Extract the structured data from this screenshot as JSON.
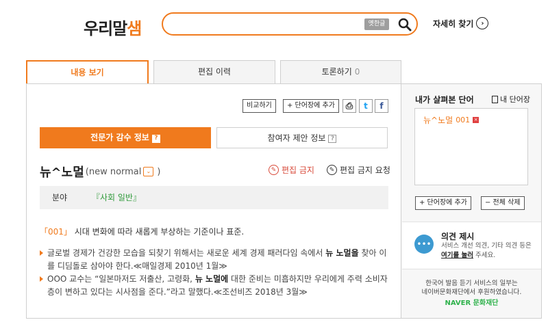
{
  "header": {
    "logo_part1": "우리말",
    "logo_part2": "샘",
    "search_value": "",
    "old_hangul_btn": "옛한글",
    "advanced_search": "자세히 찾기",
    "advanced_icon": "›"
  },
  "tabs": [
    {
      "label": "내용 보기",
      "count": ""
    },
    {
      "label": "편집 이력",
      "count": ""
    },
    {
      "label": "토론하기",
      "count": "0"
    }
  ],
  "actions": {
    "compare": "비교하기",
    "add_wordbook": "+ 단어장에 추가",
    "print_icon": "⎙",
    "twitter_icon": "t",
    "facebook_icon": "f"
  },
  "subtabs": {
    "expert": "전문가 감수 정보",
    "participant": "참여자 제안 정보",
    "qm": "?"
  },
  "entry": {
    "headword": "뉴^노멀",
    "original": "(new normal",
    "close": ")",
    "dropdown_icon": "⌄",
    "lock_edit": "편집 금지",
    "lock_edit_icon": "✎",
    "lock_request": "편집 금지 요청",
    "lock_request_icon": "✎",
    "field_label": "분야",
    "field_value": "『사회 일반』",
    "def_num": "「001」",
    "definition": "시대 변화에 따라 새롭게 부상하는 기준이나 표준.",
    "examples": [
      {
        "pre": "글로벌 경제가 건강한 모습을 되찾기 위해서는 새로운 세계 경제 패러다임 속에서 ",
        "bold": "뉴 노멀을",
        "post": " 찾아 이를 디딤돌로 삼아야 한다.≪매일경제 2010년 1월≫"
      },
      {
        "pre": "OOO 교수는 “일본마저도 저출산, 고령화, ",
        "bold": "뉴 노멀에",
        "post": " 대한 준비는 미흡하지만 우리에게 주력 소비자층이 변하고 있다는 시사점을 준다.”라고 말했다.≪조선비즈 2018년 3월≫"
      }
    ]
  },
  "side": {
    "title": "내가 살펴본 단어",
    "my_wordbook": "내 단어장",
    "items": [
      {
        "word": "뉴^노멀",
        "num": "001",
        "remove": "×"
      }
    ],
    "add_btn": "+ 단어장에 추가",
    "delete_all_btn": "− 전체 삭제",
    "opinion_title": "의견 제시",
    "opinion_text_pre": "서비스 개선 의견, 기타 의견 등은 ",
    "opinion_link": "여기를 눌러",
    "opinion_text_post": " 주세요.",
    "opinion_icon": "•••",
    "naver_text1": "한국어 발음 듣기 서비스의 일부는",
    "naver_text2": "네이버문화재단에서 후원하였습니다.",
    "naver_brand": "NAVER 문화재단"
  },
  "colors": {
    "accent": "#f07a1d",
    "green": "#2f9a3a",
    "red": "#d84a3a"
  }
}
